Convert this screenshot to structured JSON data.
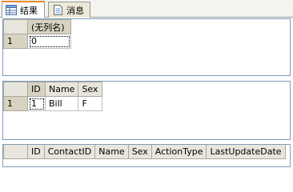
{
  "tabs": [
    {
      "label": "结果",
      "icon": "grid-icon",
      "active": true
    },
    {
      "label": "消息",
      "icon": "document-icon",
      "active": false
    }
  ],
  "result1": {
    "columns": [
      "(无列名)"
    ],
    "rows": [
      {
        "num": "1",
        "cells": [
          "0"
        ]
      }
    ]
  },
  "result2": {
    "columns": [
      "ID",
      "Name",
      "Sex"
    ],
    "rows": [
      {
        "num": "1",
        "cells": [
          "1",
          "Bill",
          "F"
        ]
      }
    ]
  },
  "result3": {
    "columns": [
      "ID",
      "ContactID",
      "Name",
      "Sex",
      "ActionType",
      "LastUpdateDate"
    ],
    "rows": []
  },
  "colors": {
    "active_tab_accent": "#e68b2c",
    "grid_header": "#e8e6dc",
    "border": "#7f9db9"
  }
}
